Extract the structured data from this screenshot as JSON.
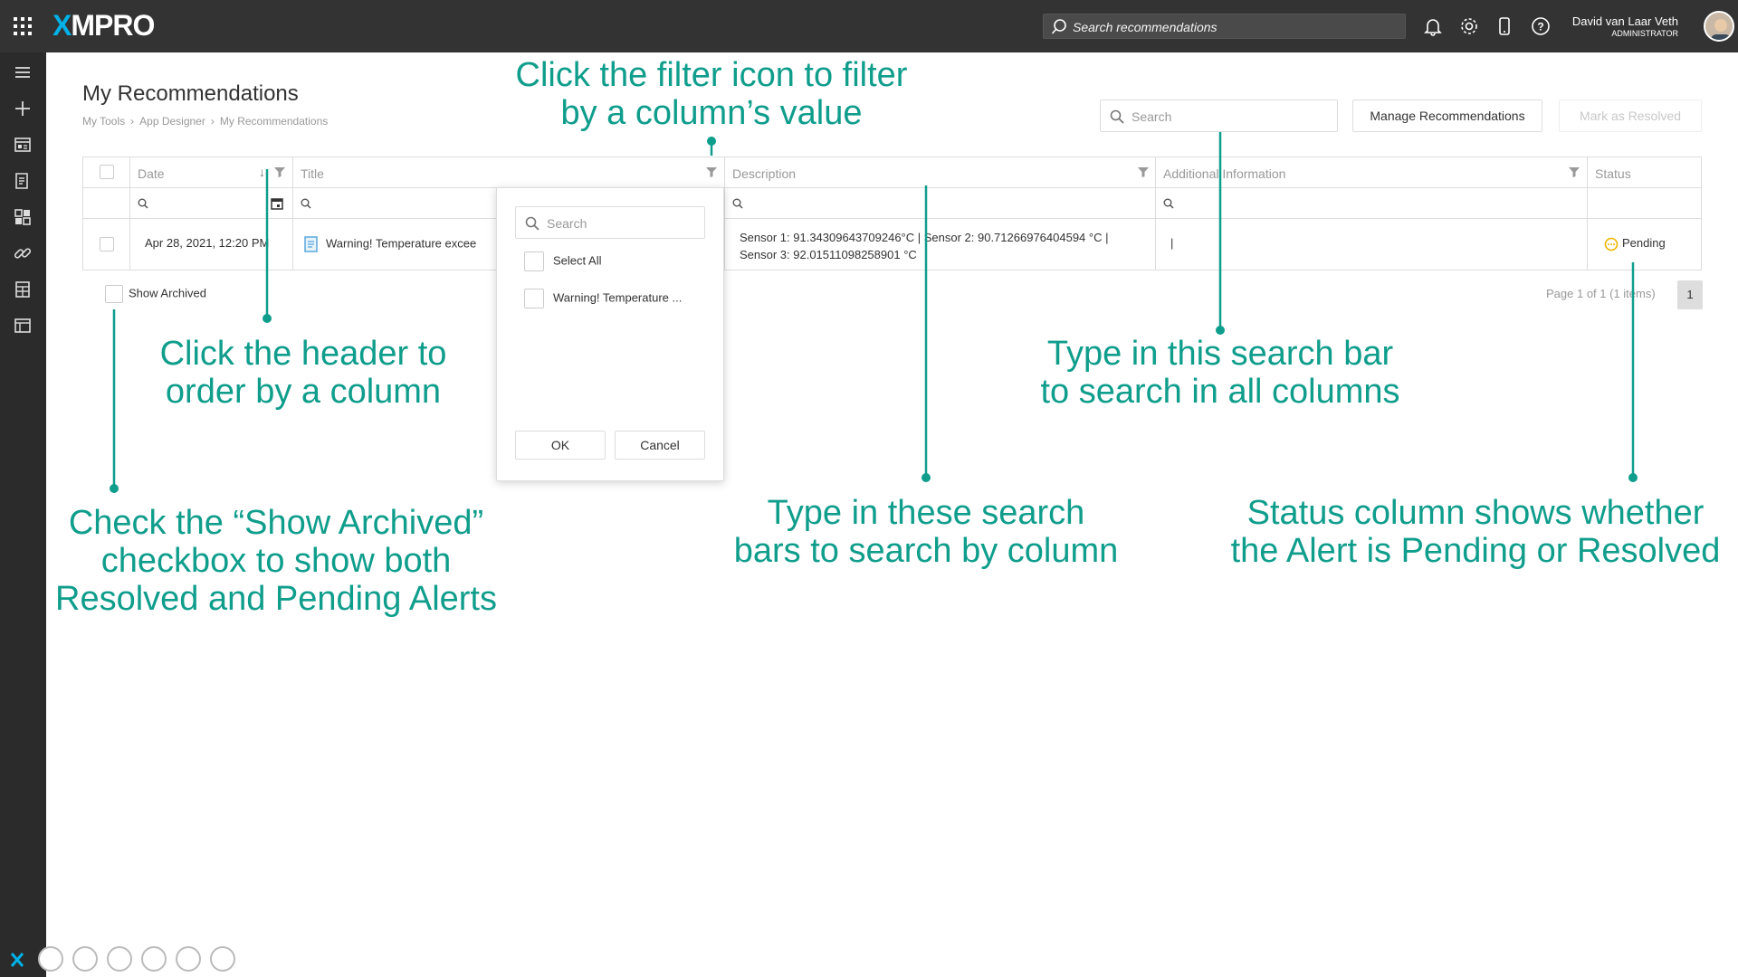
{
  "header": {
    "logo_x": "X",
    "logo_rest": "MPRO",
    "search_placeholder": "Search recommendations",
    "user_name": "David van Laar Veth",
    "user_role": "ADMINISTRATOR"
  },
  "page": {
    "title": "My Recommendations",
    "breadcrumbs": [
      "My Tools",
      "App Designer",
      "My Recommendations"
    ],
    "search_placeholder": "Search",
    "manage_button": "Manage Recommendations",
    "resolve_button": "Mark as Resolved"
  },
  "grid": {
    "columns": [
      "Date",
      "Title",
      "Description",
      "Additional Information",
      "Status"
    ],
    "rows": [
      {
        "date": "Apr 28, 2021, 12:20 PM",
        "title": "Warning! Temperature excee",
        "description_line1": "Sensor 1: 91.34309643709246°C | Sensor 2: 90.71266976404594 °C |",
        "description_line2": "Sensor 3: 92.01511098258901 °C",
        "additional": "|",
        "status": "Pending"
      }
    ],
    "pager_text": "Page 1 of 1 (1 items)",
    "pager_page": "1",
    "show_archived": "Show Archived"
  },
  "filter_popup": {
    "search_placeholder": "Search",
    "select_all": "Select All",
    "item": "Warning! Temperature ...",
    "ok": "OK",
    "cancel": "Cancel"
  },
  "annotations": {
    "filter_line1": "Click the filter icon to filter",
    "filter_line2": "by a column’s value",
    "header_line1": "Click the header to",
    "header_line2": "order by a column",
    "global_line1": "Type in this search bar",
    "global_line2": "to search in all columns",
    "archived_line1": "Check the “Show Archived”",
    "archived_line2": "checkbox to show both",
    "archived_line3": "Resolved and Pending Alerts",
    "column_line1": "Type in these search",
    "column_line2": "bars to search by column",
    "status_line1": "Status column shows whether",
    "status_line2": "the Alert is Pending or Resolved"
  },
  "colors": {
    "accent": "#0f9d8c",
    "topbar": "#333333",
    "sidebar": "#2b2b2b",
    "pending": "#f0b400"
  }
}
